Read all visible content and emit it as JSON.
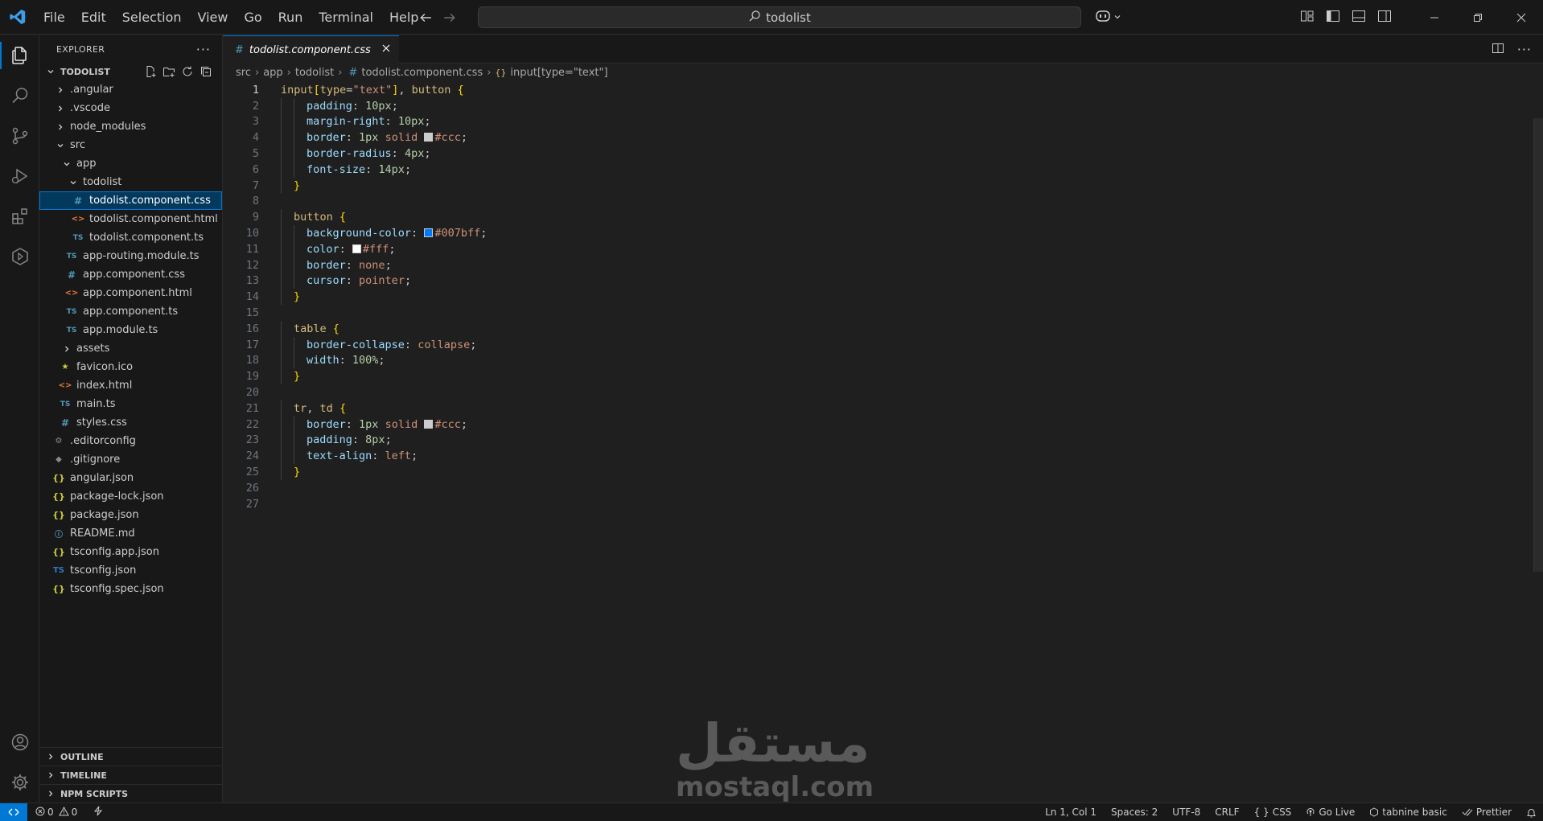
{
  "menu": [
    "File",
    "Edit",
    "Selection",
    "View",
    "Go",
    "Run",
    "Terminal",
    "Help"
  ],
  "search": {
    "text": "todolist"
  },
  "explorer": {
    "title": "EXPLORER",
    "root": "TODOLIST",
    "items": [
      {
        "label": ".angular",
        "depth": 1,
        "type": "folder",
        "open": false
      },
      {
        "label": ".vscode",
        "depth": 1,
        "type": "folder",
        "open": false
      },
      {
        "label": "node_modules",
        "depth": 1,
        "type": "folder",
        "open": false
      },
      {
        "label": "src",
        "depth": 1,
        "type": "folder",
        "open": true
      },
      {
        "label": "app",
        "depth": 2,
        "type": "folder",
        "open": true
      },
      {
        "label": "todolist",
        "depth": 3,
        "type": "folder",
        "open": true
      },
      {
        "label": "todolist.component.css",
        "depth": 4,
        "type": "css",
        "selected": true
      },
      {
        "label": "todolist.component.html",
        "depth": 4,
        "type": "html"
      },
      {
        "label": "todolist.component.ts",
        "depth": 4,
        "type": "ts"
      },
      {
        "label": "app-routing.module.ts",
        "depth": 3,
        "type": "ts"
      },
      {
        "label": "app.component.css",
        "depth": 3,
        "type": "css"
      },
      {
        "label": "app.component.html",
        "depth": 3,
        "type": "html"
      },
      {
        "label": "app.component.ts",
        "depth": 3,
        "type": "ts"
      },
      {
        "label": "app.module.ts",
        "depth": 3,
        "type": "ts"
      },
      {
        "label": "assets",
        "depth": 2,
        "type": "folder",
        "open": false
      },
      {
        "label": "favicon.ico",
        "depth": 2,
        "type": "fav"
      },
      {
        "label": "index.html",
        "depth": 2,
        "type": "html"
      },
      {
        "label": "main.ts",
        "depth": 2,
        "type": "ts"
      },
      {
        "label": "styles.css",
        "depth": 2,
        "type": "css"
      },
      {
        "label": ".editorconfig",
        "depth": 1,
        "type": "gear"
      },
      {
        "label": ".gitignore",
        "depth": 1,
        "type": "git"
      },
      {
        "label": "angular.json",
        "depth": 1,
        "type": "json"
      },
      {
        "label": "package-lock.json",
        "depth": 1,
        "type": "json"
      },
      {
        "label": "package.json",
        "depth": 1,
        "type": "json"
      },
      {
        "label": "README.md",
        "depth": 1,
        "type": "info"
      },
      {
        "label": "tsconfig.app.json",
        "depth": 1,
        "type": "json"
      },
      {
        "label": "tsconfig.json",
        "depth": 1,
        "type": "tsc"
      },
      {
        "label": "tsconfig.spec.json",
        "depth": 1,
        "type": "json"
      }
    ],
    "sections": [
      "OUTLINE",
      "TIMELINE",
      "NPM SCRIPTS"
    ]
  },
  "tab": {
    "label": "todolist.component.css",
    "icon": "#"
  },
  "breadcrumbs": {
    "src": "src",
    "app": "app",
    "folder": "todolist",
    "file": "todolist.component.css",
    "symbol": "input[type=\"text\"]"
  },
  "code": [
    {
      "n": "1",
      "html": "<span class=\"sel\">input</span><span class=\"br\">[</span><span class=\"sel\">type</span><span class=\"pn\">=</span><span class=\"val\">\"text\"</span><span class=\"br\">]</span><span class=\"pn\">, </span><span class=\"sel\">button</span><span class=\"pn\"> </span><span class=\"br\">{</span>"
    },
    {
      "n": "2",
      "indent": 2,
      "html": "<span class=\"prop\">padding</span><span class=\"pn\">: </span><span class=\"num\">10px</span><span class=\"pn\">;</span>"
    },
    {
      "n": "3",
      "indent": 2,
      "html": "<span class=\"prop\">margin-right</span><span class=\"pn\">: </span><span class=\"num\">10px</span><span class=\"pn\">;</span>"
    },
    {
      "n": "4",
      "indent": 2,
      "html": "<span class=\"prop\">border</span><span class=\"pn\">: </span><span class=\"num\">1px</span><span class=\"pn\"> </span><span class=\"val\">solid</span><span class=\"pn\"> </span><span class=\"swatch\" style=\"background:#ccc\"></span><span class=\"val\">#ccc</span><span class=\"pn\">;</span>"
    },
    {
      "n": "5",
      "indent": 2,
      "html": "<span class=\"prop\">border-radius</span><span class=\"pn\">: </span><span class=\"num\">4px</span><span class=\"pn\">;</span>"
    },
    {
      "n": "6",
      "indent": 2,
      "html": "<span class=\"prop\">font-size</span><span class=\"pn\">: </span><span class=\"num\">14px</span><span class=\"pn\">;</span>"
    },
    {
      "n": "7",
      "indent": 1,
      "html": "<span class=\"br\">}</span>"
    },
    {
      "n": "8",
      "indent": 0,
      "html": ""
    },
    {
      "n": "9",
      "indent": 1,
      "html": "<span class=\"sel\">button</span><span class=\"pn\"> </span><span class=\"br\">{</span>"
    },
    {
      "n": "10",
      "indent": 2,
      "html": "<span class=\"prop\">background-color</span><span class=\"pn\">: </span><span class=\"swatch\" style=\"background:#007bff\"></span><span class=\"val\">#007bff</span><span class=\"pn\">;</span>"
    },
    {
      "n": "11",
      "indent": 2,
      "html": "<span class=\"prop\">color</span><span class=\"pn\">: </span><span class=\"swatch\" style=\"background:#fff\"></span><span class=\"val\">#fff</span><span class=\"pn\">;</span>"
    },
    {
      "n": "12",
      "indent": 2,
      "html": "<span class=\"prop\">border</span><span class=\"pn\">: </span><span class=\"val\">none</span><span class=\"pn\">;</span>"
    },
    {
      "n": "13",
      "indent": 2,
      "html": "<span class=\"prop\">cursor</span><span class=\"pn\">: </span><span class=\"val\">pointer</span><span class=\"pn\">;</span>"
    },
    {
      "n": "14",
      "indent": 1,
      "html": "<span class=\"br\">}</span>"
    },
    {
      "n": "15",
      "indent": 0,
      "html": ""
    },
    {
      "n": "16",
      "indent": 1,
      "html": "<span class=\"sel\">table</span><span class=\"pn\"> </span><span class=\"br\">{</span>"
    },
    {
      "n": "17",
      "indent": 2,
      "html": "<span class=\"prop\">border-collapse</span><span class=\"pn\">: </span><span class=\"val\">collapse</span><span class=\"pn\">;</span>"
    },
    {
      "n": "18",
      "indent": 2,
      "html": "<span class=\"prop\">width</span><span class=\"pn\">: </span><span class=\"num\">100%</span><span class=\"pn\">;</span>"
    },
    {
      "n": "19",
      "indent": 1,
      "html": "<span class=\"br\">}</span>"
    },
    {
      "n": "20",
      "indent": 0,
      "html": ""
    },
    {
      "n": "21",
      "indent": 1,
      "html": "<span class=\"sel\">tr</span><span class=\"pn\">, </span><span class=\"sel\">td</span><span class=\"pn\"> </span><span class=\"br\">{</span>"
    },
    {
      "n": "22",
      "indent": 2,
      "html": "<span class=\"prop\">border</span><span class=\"pn\">: </span><span class=\"num\">1px</span><span class=\"pn\"> </span><span class=\"val\">solid</span><span class=\"pn\"> </span><span class=\"swatch\" style=\"background:#ccc\"></span><span class=\"val\">#ccc</span><span class=\"pn\">;</span>"
    },
    {
      "n": "23",
      "indent": 2,
      "html": "<span class=\"prop\">padding</span><span class=\"pn\">: </span><span class=\"num\">8px</span><span class=\"pn\">;</span>"
    },
    {
      "n": "24",
      "indent": 2,
      "html": "<span class=\"prop\">text-align</span><span class=\"pn\">: </span><span class=\"val\">left</span><span class=\"pn\">;</span>"
    },
    {
      "n": "25",
      "indent": 1,
      "html": "<span class=\"br\">}</span>"
    },
    {
      "n": "26",
      "indent": 0,
      "html": ""
    },
    {
      "n": "27",
      "indent": 0,
      "html": ""
    }
  ],
  "watermark": {
    "arabic": "مستقل",
    "latin": "mostaql.com"
  },
  "status": {
    "errors": "0",
    "warnings": "0",
    "position": "Ln 1, Col 1",
    "spaces": "Spaces: 2",
    "encoding": "UTF-8",
    "eol": "CRLF",
    "language": "CSS",
    "golive": "Go Live",
    "tabnine": "tabnine basic",
    "prettier": "Prettier"
  }
}
